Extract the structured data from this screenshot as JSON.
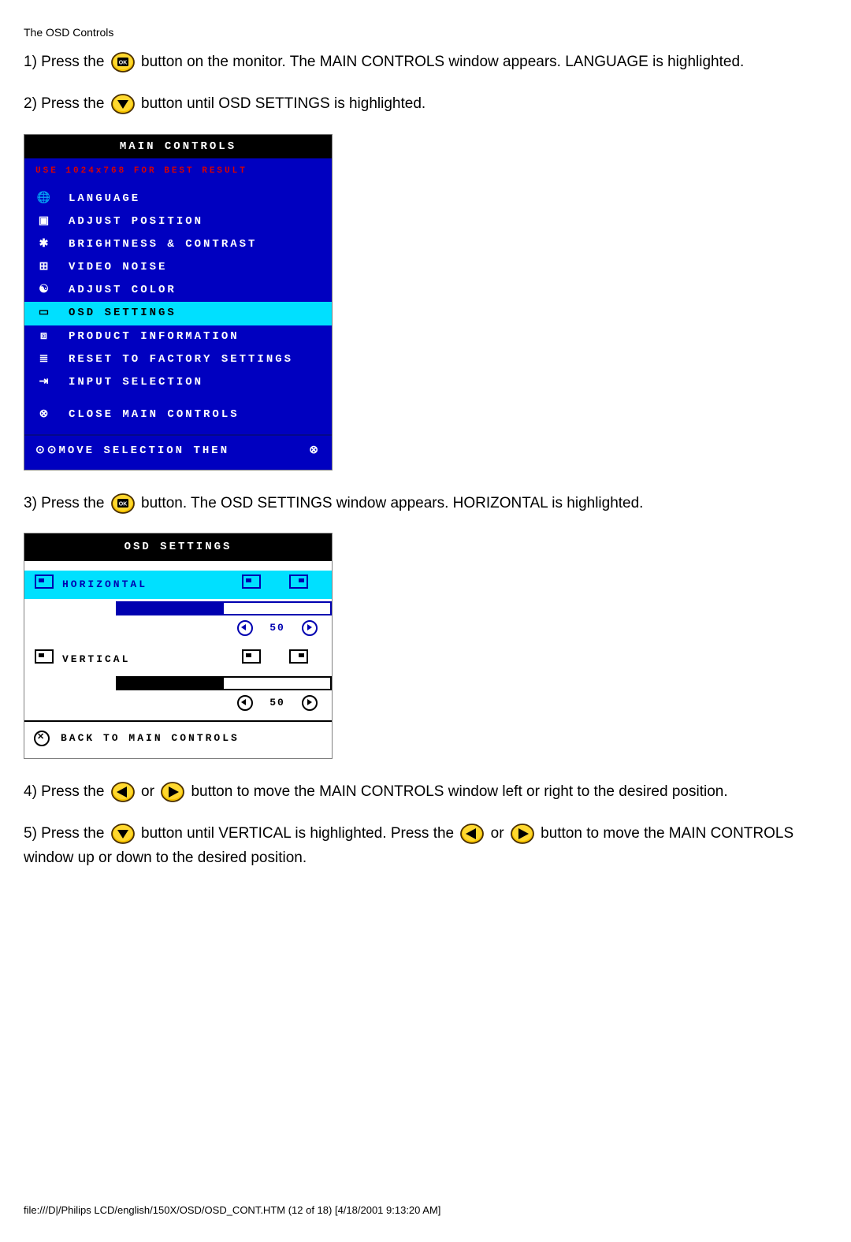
{
  "doc_title": "The OSD Controls",
  "steps": {
    "s1a": "1) Press the ",
    "s1b": " button on the monitor. The MAIN CONTROLS window appears. LANGUAGE is highlighted.",
    "s2a": "2) Press the ",
    "s2b": " button until OSD SETTINGS is highlighted.",
    "s3a": "3) Press the ",
    "s3b": " button. The OSD SETTINGS window appears. HORIZONTAL is highlighted.",
    "s4a": "4) Press the ",
    "s4b": " or ",
    "s4c": " button to move the MAIN CONTROLS window left or right to the desired position.",
    "s5a": "5) Press the ",
    "s5b": " button until VERTICAL is highlighted. Press the ",
    "s5c": " or ",
    "s5d": " button to move the MAIN CONTROLS window up or down to the desired position."
  },
  "main_controls": {
    "title": "MAIN CONTROLS",
    "hint": "USE 1024x768 FOR BEST RESULT",
    "items": [
      {
        "icon": "🌐",
        "label": "LANGUAGE",
        "selected": false
      },
      {
        "icon": "▣",
        "label": "ADJUST POSITION",
        "selected": false
      },
      {
        "icon": "✱",
        "label": "BRIGHTNESS & CONTRAST",
        "selected": false
      },
      {
        "icon": "⊞",
        "label": "VIDEO NOISE",
        "selected": false
      },
      {
        "icon": "☯",
        "label": "ADJUST COLOR",
        "selected": false
      },
      {
        "icon": "▭",
        "label": "OSD SETTINGS",
        "selected": true
      },
      {
        "icon": "⧈",
        "label": "PRODUCT INFORMATION",
        "selected": false
      },
      {
        "icon": "≣",
        "label": "RESET TO FACTORY SETTINGS",
        "selected": false
      },
      {
        "icon": "⇥",
        "label": "INPUT SELECTION",
        "selected": false
      }
    ],
    "close": {
      "icon": "⊗",
      "label": "CLOSE MAIN CONTROLS"
    },
    "footer": {
      "icons": "⊙⊙",
      "text": "MOVE SELECTION THEN",
      "end": "⊗"
    }
  },
  "osd_settings": {
    "title": "OSD SETTINGS",
    "rows": [
      {
        "label": "HORIZONTAL",
        "value": 50,
        "selected": true
      },
      {
        "label": "VERTICAL",
        "value": 50,
        "selected": false
      }
    ],
    "back": {
      "label": "BACK TO MAIN CONTROLS"
    }
  },
  "footer_path": "file:///D|/Philips LCD/english/150X/OSD/OSD_CONT.HTM (12 of 18) [4/18/2001 9:13:20 AM]"
}
